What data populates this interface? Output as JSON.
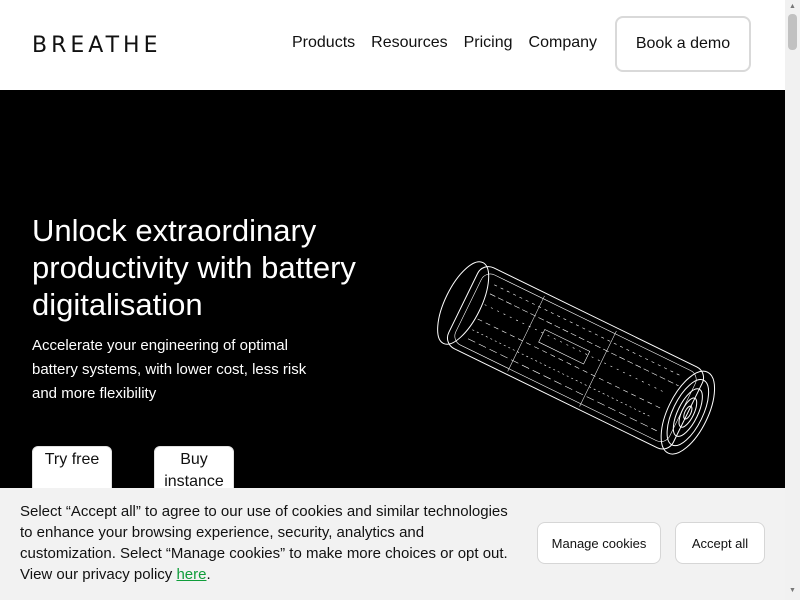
{
  "header": {
    "logo": "BREATHE",
    "nav": [
      "Products",
      "Resources",
      "Pricing",
      "Company"
    ],
    "demo_button": "Book a demo"
  },
  "hero": {
    "title": "Unlock extraordinary productivity with battery digitalisation",
    "subtitle": "Accelerate your engineering of optimal battery systems, with lower cost, less risk and more flexibility",
    "cta_primary": "Try free",
    "cta_secondary": "Buy instance",
    "image_icon": "battery-cell-wireframe"
  },
  "cookie": {
    "text_before": "Select “Accept all” to agree to our use of cookies and similar technologies to enhance your browsing experience, security, analytics and customization. Select “Manage cookies” to make more choices or opt out. View our privacy policy ",
    "link": "here",
    "text_after": ".",
    "manage_button": "Manage cookies",
    "accept_button": "Accept all"
  },
  "colors": {
    "hero_bg": "#000000",
    "cookie_bg": "#f2f2f2",
    "link": "#0f9d3a"
  }
}
